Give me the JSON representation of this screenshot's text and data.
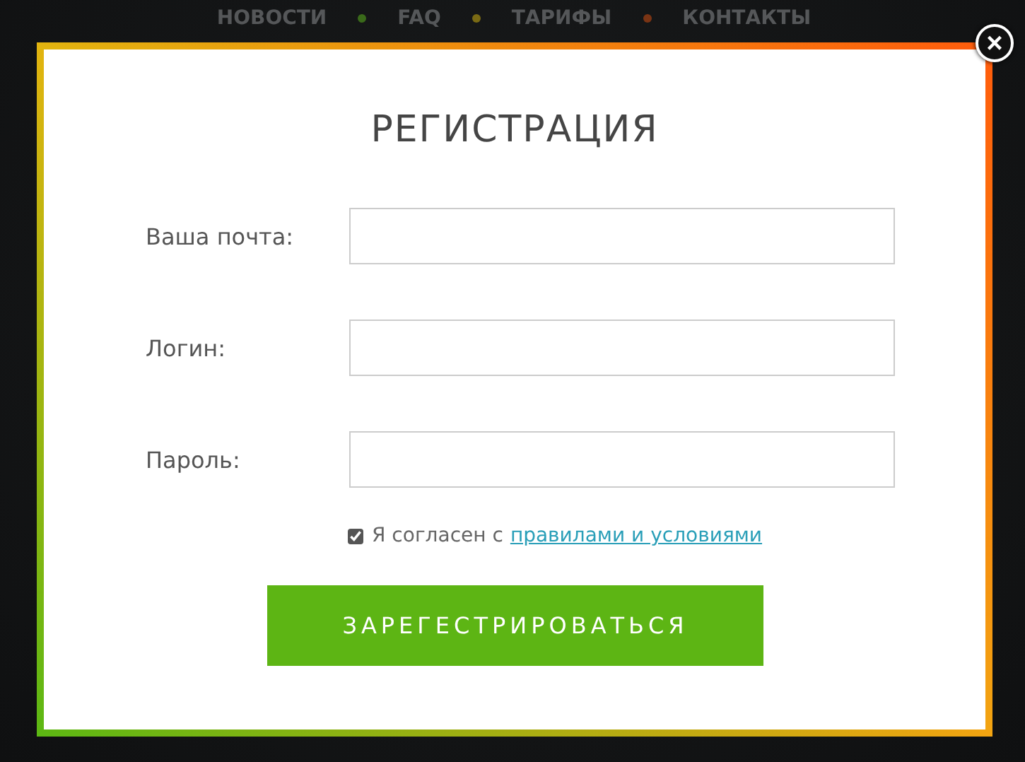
{
  "nav": {
    "items": [
      {
        "label": "НОВОСТИ"
      },
      {
        "label": "FAQ"
      },
      {
        "label": "ТАРИФЫ"
      },
      {
        "label": "КОНТАКТЫ"
      }
    ],
    "separators": [
      {
        "color": "#3a6a1a"
      },
      {
        "color": "#7a6a14"
      },
      {
        "color": "#7a3414"
      }
    ]
  },
  "modal": {
    "close": "×",
    "title": "РЕГИСТРАЦИЯ",
    "fields": [
      {
        "label": "Ваша почта:"
      },
      {
        "label": "Логин:"
      },
      {
        "label": "Пароль:"
      }
    ],
    "agree": {
      "checked": true,
      "text": "Я согласен с",
      "link": "правилами и условиями"
    },
    "submit": "ЗАРЕГЕСТРИРОВАТЬСЯ"
  }
}
